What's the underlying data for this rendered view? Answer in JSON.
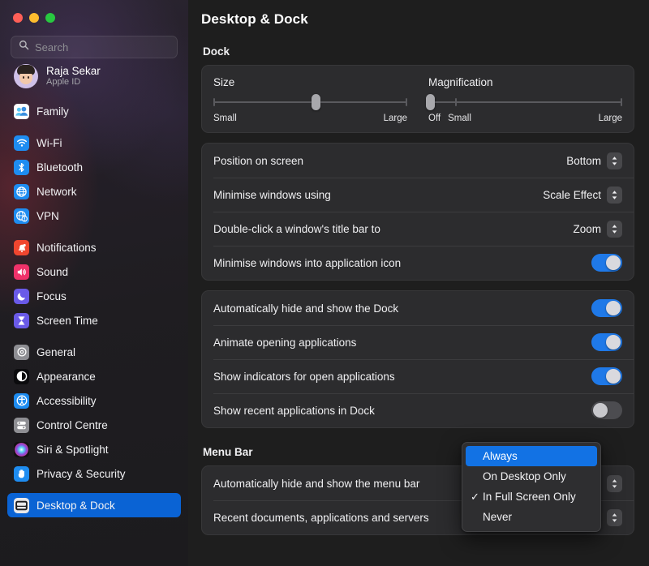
{
  "window": {
    "traffic_lights": [
      {
        "name": "close",
        "color": "#ff5f57"
      },
      {
        "name": "minimize",
        "color": "#febc2e"
      },
      {
        "name": "zoom",
        "color": "#28c840"
      }
    ]
  },
  "sidebar": {
    "search": {
      "placeholder": "Search",
      "value": ""
    },
    "account": {
      "name": "Raja Sekar",
      "subtitle": "Apple ID"
    },
    "groups": [
      {
        "items": [
          {
            "label": "Family",
            "icon": "family-icon"
          }
        ]
      },
      {
        "items": [
          {
            "label": "Wi-Fi",
            "icon": "wifi-icon"
          },
          {
            "label": "Bluetooth",
            "icon": "bluetooth-icon"
          },
          {
            "label": "Network",
            "icon": "network-icon"
          },
          {
            "label": "VPN",
            "icon": "vpn-icon"
          }
        ]
      },
      {
        "items": [
          {
            "label": "Notifications",
            "icon": "notifications-icon"
          },
          {
            "label": "Sound",
            "icon": "sound-icon"
          },
          {
            "label": "Focus",
            "icon": "focus-icon"
          },
          {
            "label": "Screen Time",
            "icon": "screen-time-icon"
          }
        ]
      },
      {
        "items": [
          {
            "label": "General",
            "icon": "general-icon"
          },
          {
            "label": "Appearance",
            "icon": "appearance-icon"
          },
          {
            "label": "Accessibility",
            "icon": "accessibility-icon"
          },
          {
            "label": "Control Centre",
            "icon": "control-centre-icon"
          },
          {
            "label": "Siri & Spotlight",
            "icon": "siri-icon"
          },
          {
            "label": "Privacy & Security",
            "icon": "privacy-icon"
          }
        ]
      },
      {
        "items": [
          {
            "label": "Desktop & Dock",
            "icon": "desktop-dock-icon",
            "selected": true
          }
        ]
      }
    ]
  },
  "main": {
    "title": "Desktop & Dock",
    "dock_section": {
      "heading": "Dock",
      "sliders": [
        {
          "label": "Size",
          "min_label": "Small",
          "max_label": "Large",
          "value_percent": 53
        },
        {
          "label": "Magnification",
          "off_label": "Off",
          "min_label": "Small",
          "max_label": "Large",
          "value_percent": 1
        }
      ],
      "popup_rows": [
        {
          "label": "Position on screen",
          "value": "Bottom"
        },
        {
          "label": "Minimise windows using",
          "value": "Scale Effect"
        },
        {
          "label": "Double-click a window's title bar to",
          "value": "Zoom"
        }
      ],
      "toggle_row": {
        "label": "Minimise windows into application icon",
        "on": true
      },
      "toggle_rows": [
        {
          "label": "Automatically hide and show the Dock",
          "on": true
        },
        {
          "label": "Animate opening applications",
          "on": true
        },
        {
          "label": "Show indicators for open applications",
          "on": true
        },
        {
          "label": "Show recent applications in Dock",
          "on": false
        }
      ]
    },
    "menu_bar_section": {
      "heading": "Menu Bar",
      "rows": [
        {
          "label": "Automatically hide and show the menu bar",
          "value": "In Full Screen Only"
        },
        {
          "label": "Recent documents, applications and servers",
          "value": ""
        }
      ]
    }
  },
  "dropdown": {
    "open": true,
    "items": [
      {
        "label": "Always",
        "highlighted": true,
        "checked": false
      },
      {
        "label": "On Desktop Only",
        "highlighted": false,
        "checked": false
      },
      {
        "label": "In Full Screen Only",
        "highlighted": false,
        "checked": true
      },
      {
        "label": "Never",
        "highlighted": false,
        "checked": false
      }
    ],
    "check_glyph": "✓"
  },
  "colors": {
    "accent": "#0a63d4",
    "toggle_on": "#1f79e8",
    "menu_highlight": "#1272e4",
    "card_bg": "#2c2c2e",
    "content_bg": "#1e1e1e"
  }
}
